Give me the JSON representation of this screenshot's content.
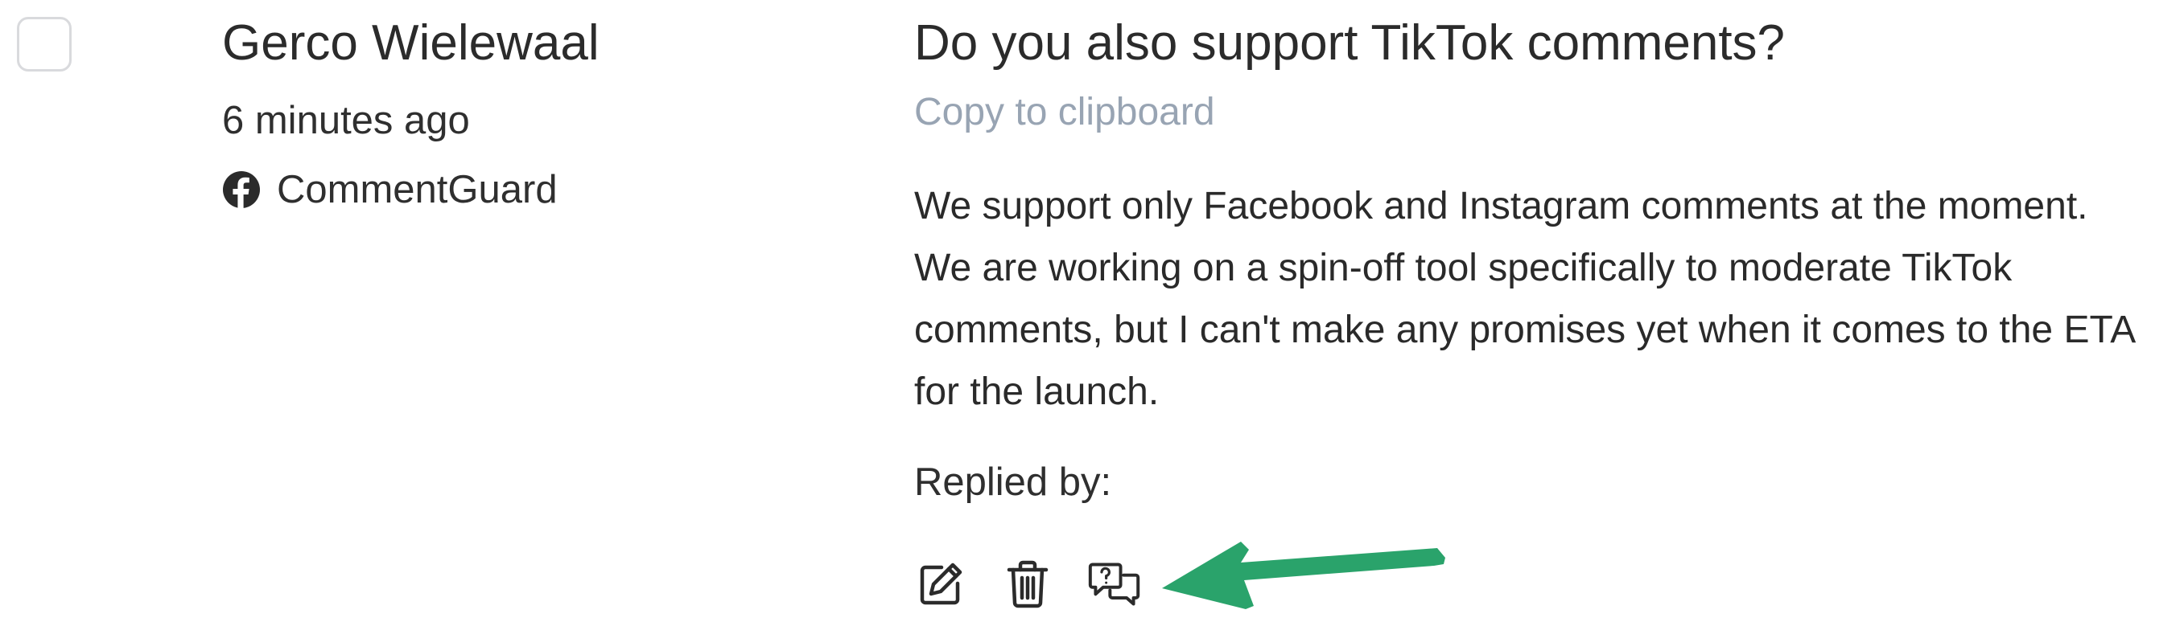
{
  "comment": {
    "author": "Gerco Wielewaal",
    "time": "6 minutes ago",
    "source": {
      "icon": "facebook-icon",
      "label": "CommentGuard"
    },
    "question": "Do you also support TikTok comments?",
    "copy_label": "Copy to clipboard",
    "reply_lines": [
      "We support only Facebook and Instagram comments at the moment.",
      "We are working on a spin-off tool specifically to moderate TikTok",
      "comments, but I can't make any promises yet when it comes to the ETA",
      "for the launch."
    ],
    "replied_by_label": "Replied by:"
  },
  "actions": [
    {
      "icon": "edit-icon"
    },
    {
      "icon": "trash-icon"
    },
    {
      "icon": "question-chat-icon"
    }
  ],
  "colors": {
    "text": "#2b2b2b",
    "link": "#98a4b3",
    "checkbox_border": "#d9dadd",
    "annotation_arrow": "#2aa36b"
  }
}
